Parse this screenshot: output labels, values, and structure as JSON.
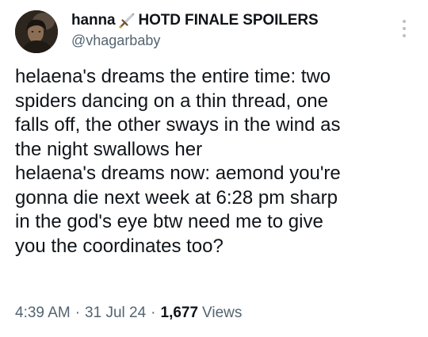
{
  "author": {
    "display_name": "hanna",
    "name_suffix": "HOTD FINALE SPOILERS",
    "name_icon": "dagger-icon",
    "handle": "@vhagarbaby"
  },
  "tweet": {
    "lines": [
      "helaena's dreams the entire time: two",
      "spiders dancing on a thin thread, one",
      "falls off, the other sways in the wind as",
      "the night swallows her",
      "helaena's dreams now: aemond you're",
      "gonna die next week at 6:28 pm sharp",
      "in the god's eye btw need me to give",
      "you the coordinates too?"
    ]
  },
  "meta": {
    "time": "4:39 AM",
    "separator": "·",
    "date": "31 Jul 24",
    "views_count": "1,677",
    "views_label": "Views"
  },
  "colors": {
    "text_primary": "#0f1419",
    "text_secondary": "#536471",
    "more_dots": "#b8c0c6"
  }
}
